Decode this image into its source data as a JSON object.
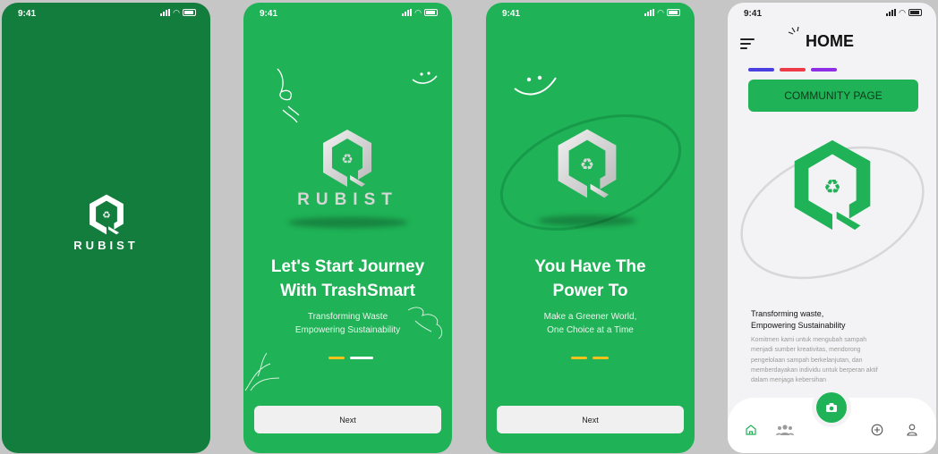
{
  "status_bar": {
    "time": "9:41"
  },
  "splash": {
    "brand": "RUBIST"
  },
  "onboarding1": {
    "brand": "RUBIST",
    "title_line1": "Let's Start Journey",
    "title_line2": "With TrashSmart",
    "subtitle_line1": "Transforming Waste",
    "subtitle_line2": "Empowering Sustainability",
    "next_label": "Next"
  },
  "onboarding2": {
    "title_line1": "You Have The",
    "title_line2": "Power To",
    "subtitle_line1": "Make a Greener World,",
    "subtitle_line2": "One Choice at a Time",
    "next_label": "Next"
  },
  "home": {
    "title": "HOME",
    "community_button": "COMMUNITY PAGE",
    "heading_line1": "Transforming waste,",
    "heading_line2": "Empowering Sustainability",
    "body_line1": "Komitmen kami untuk mengubah sampah",
    "body_line2": "menjadi sumber kreativitas, mendorong",
    "body_line3": "pengelolaan sampah berkelanjutan, dan",
    "body_line4": "memberdayakan individu untuk berperan aktif",
    "body_line5": "dalam menjaga kebersihan",
    "tab_colors": [
      "#4a3fe0",
      "#ef3b47",
      "#8e2fe6"
    ],
    "nav_icons": [
      "home-icon",
      "community-icon",
      "camera-icon",
      "add-icon",
      "profile-icon"
    ]
  },
  "colors": {
    "splash_bg": "#137d3d",
    "primary": "#1fb256",
    "accent_yellow": "#f2c21b"
  }
}
